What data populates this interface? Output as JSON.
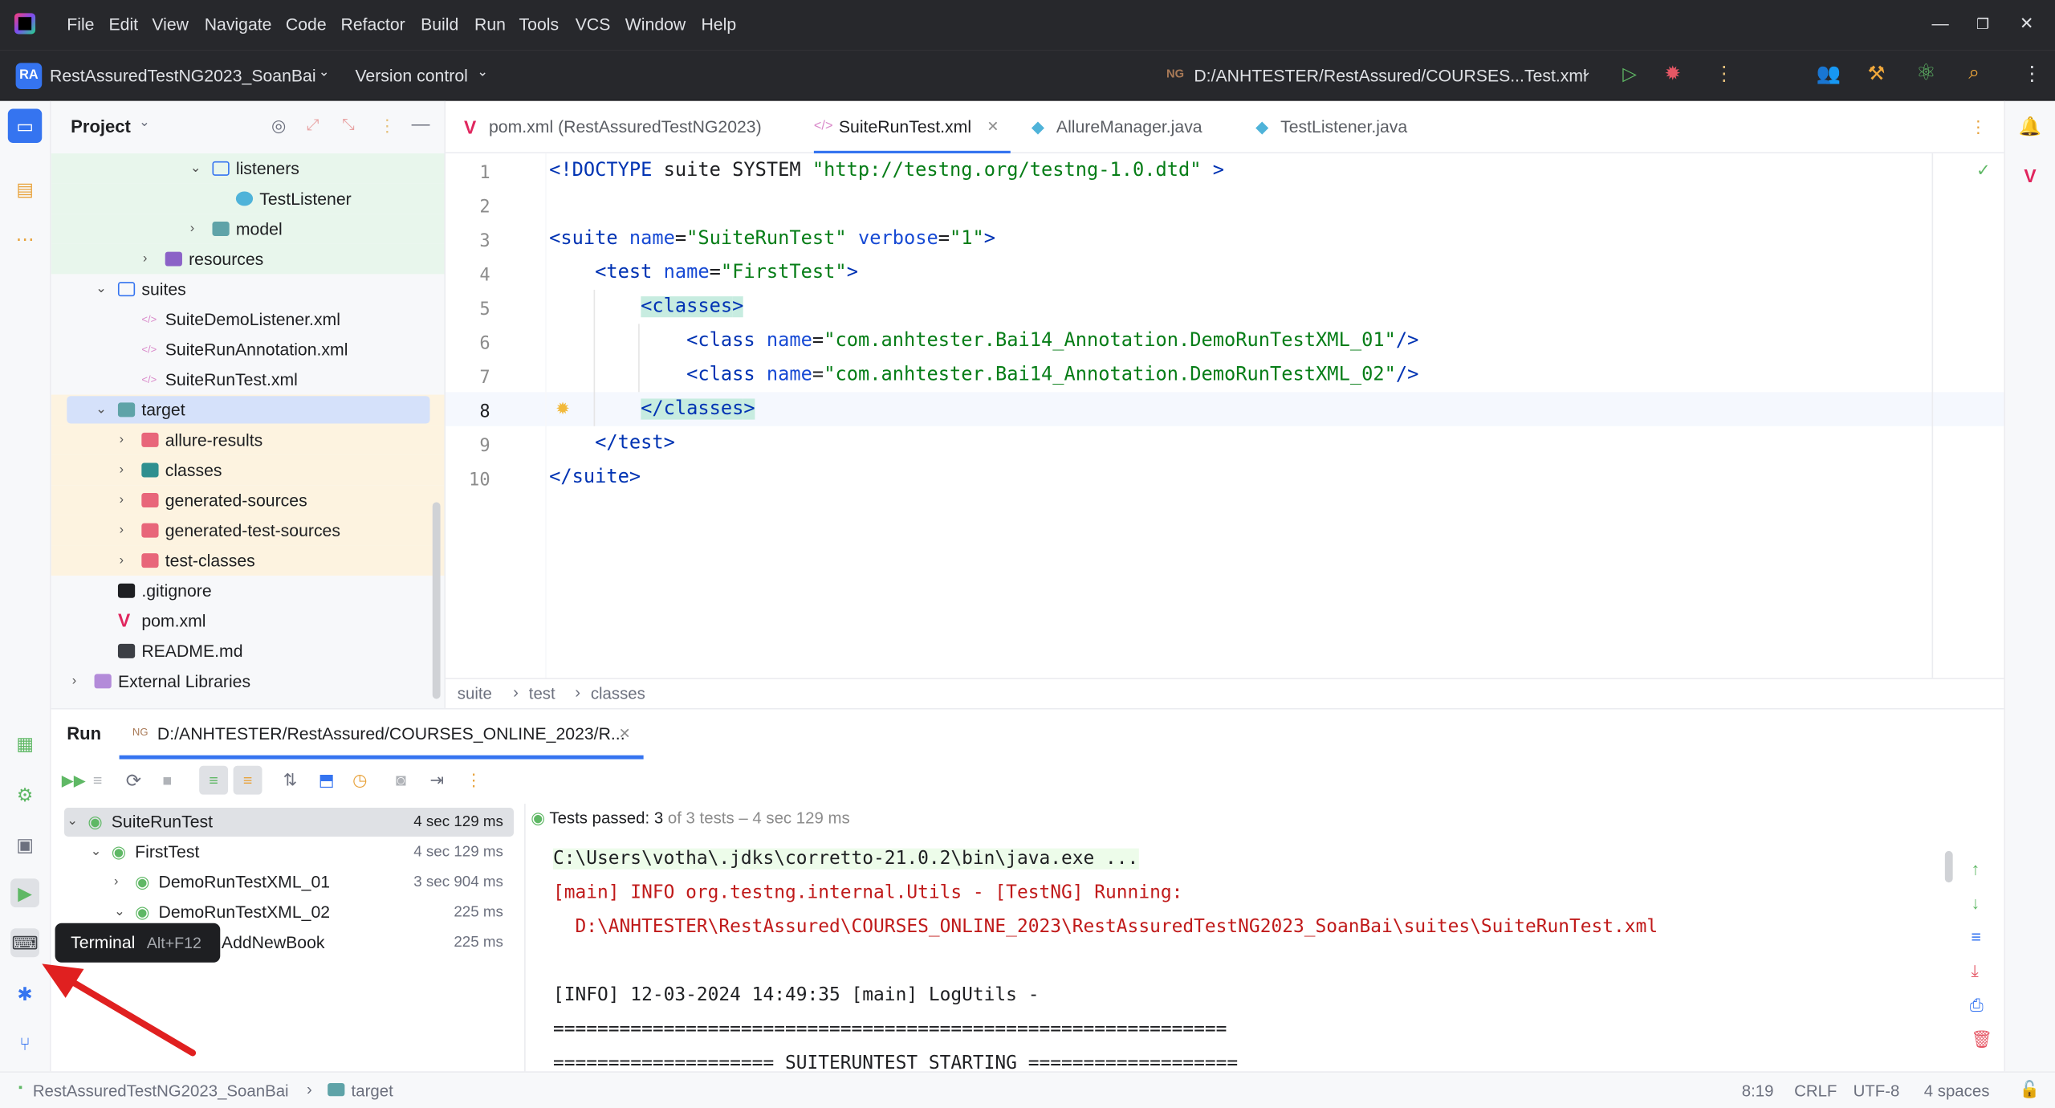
{
  "menu": [
    "File",
    "Edit",
    "View",
    "Navigate",
    "Code",
    "Refactor",
    "Build",
    "Run",
    "Tools",
    "VCS",
    "Window",
    "Help"
  ],
  "toolbar": {
    "project_badge": "RA",
    "project_name": "RestAssuredTestNG2023_SoanBai",
    "vcs_label": "Version control",
    "run_config": "D:/ANHTESTER/RestAssured/COURSES...Test.xml"
  },
  "project_panel": {
    "title": "Project",
    "items": [
      {
        "label": "listeners",
        "depth": 5,
        "type": "folder",
        "expanded": true
      },
      {
        "label": "TestListener",
        "depth": 6,
        "type": "class"
      },
      {
        "label": "model",
        "depth": 5,
        "type": "package",
        "expanded": false
      },
      {
        "label": "resources",
        "depth": 3,
        "type": "resources",
        "expanded": false
      },
      {
        "label": "suites",
        "depth": 1,
        "type": "folder",
        "expanded": true
      },
      {
        "label": "SuiteDemoListener.xml",
        "depth": 2,
        "type": "xml"
      },
      {
        "label": "SuiteRunAnnotation.xml",
        "depth": 2,
        "type": "xml"
      },
      {
        "label": "SuiteRunTest.xml",
        "depth": 2,
        "type": "xml"
      },
      {
        "label": "target",
        "depth": 1,
        "type": "target",
        "expanded": true
      },
      {
        "label": "allure-results",
        "depth": 2,
        "type": "excluded",
        "expanded": false
      },
      {
        "label": "classes",
        "depth": 2,
        "type": "excluded-teal",
        "expanded": false
      },
      {
        "label": "generated-sources",
        "depth": 2,
        "type": "excluded",
        "expanded": false
      },
      {
        "label": "generated-test-sources",
        "depth": 2,
        "type": "excluded",
        "expanded": false
      },
      {
        "label": "test-classes",
        "depth": 2,
        "type": "excluded",
        "expanded": false
      },
      {
        "label": ".gitignore",
        "depth": 1,
        "type": "git"
      },
      {
        "label": "pom.xml",
        "depth": 1,
        "type": "maven"
      },
      {
        "label": "README.md",
        "depth": 1,
        "type": "md"
      },
      {
        "label": "External Libraries",
        "depth": 0,
        "type": "lib",
        "expanded": false
      }
    ]
  },
  "tabs": [
    {
      "label": "pom.xml (RestAssuredTestNG2023)",
      "icon": "maven-icon",
      "active": false
    },
    {
      "label": "SuiteRunTest.xml",
      "icon": "xml-icon",
      "active": true
    },
    {
      "label": "AllureManager.java",
      "icon": "class-icon",
      "active": false
    },
    {
      "label": "TestListener.java",
      "icon": "class-icon",
      "active": false
    }
  ],
  "editor": {
    "line_numbers": [
      "1",
      "2",
      "3",
      "4",
      "5",
      "6",
      "7",
      "8",
      "9",
      "10"
    ],
    "lines": [
      "<!DOCTYPE suite SYSTEM \"http://testng.org/testng-1.0.dtd\" >",
      "",
      "<suite name=\"SuiteRunTest\" verbose=\"1\">",
      "    <test name=\"FirstTest\">",
      "        <classes>",
      "            <class name=\"com.anhtester.Bai14_Annotation.DemoRunTestXML_01\"/>",
      "            <class name=\"com.anhtester.Bai14_Annotation.DemoRunTestXML_02\"/>",
      "        </classes>",
      "    </test>",
      "</suite>"
    ],
    "current_line": 8
  },
  "breadcrumb": [
    "suite",
    "test",
    "classes"
  ],
  "run_panel": {
    "title": "Run",
    "tab_label": "D:/ANHTESTER/RestAssured/COURSES_ONLINE_2023/R...",
    "summary_prefix": "Tests passed: ",
    "summary_count": "3",
    "summary_rest": " of 3 tests – 4 sec 129 ms",
    "tree": [
      {
        "label": "SuiteRunTest",
        "time": "4 sec 129 ms",
        "depth": 0
      },
      {
        "label": "FirstTest",
        "time": "4 sec 129 ms",
        "depth": 1
      },
      {
        "label": "DemoRunTestXML_01",
        "time": "3 sec 904 ms",
        "depth": 2
      },
      {
        "label": "DemoRunTestXML_02",
        "time": "225 ms",
        "depth": 2
      },
      {
        "label": "AddNewBook",
        "time": "225 ms",
        "depth": 3
      }
    ],
    "console": [
      {
        "text": "C:\\Users\\votha\\.jdks\\corretto-21.0.2\\bin\\java.exe ...",
        "color": "#1e1f22",
        "bg": "#edfcea"
      },
      {
        "text": "[main] INFO org.testng.internal.Utils - [TestNG] Running:",
        "color": "#c01a1a"
      },
      {
        "text": "  D:\\ANHTESTER\\RestAssured\\COURSES_ONLINE_2023\\RestAssuredTestNG2023_SoanBai\\suites\\SuiteRunTest.xml",
        "color": "#c01a1a"
      },
      {
        "text": "",
        "color": "#1e1f22"
      },
      {
        "text": "[INFO] 12-03-2024 14:49:35 [main] LogUtils -",
        "color": "#1e1f22"
      },
      {
        "text": "=============================================================",
        "color": "#1e1f22"
      },
      {
        "text": "==================== SUITERUNTEST STARTING ===================",
        "color": "#1e1f22"
      }
    ]
  },
  "tooltip": {
    "label": "Terminal",
    "shortcut": "Alt+F12"
  },
  "statusbar": {
    "project": "RestAssuredTestNG2023_SoanBai",
    "folder": "target",
    "position": "8:19",
    "line_ending": "CRLF",
    "encoding": "UTF-8",
    "indent": "4 spaces"
  },
  "colors": {
    "accent": "#3574f0",
    "pass": "#369650",
    "annotation_arrow": "#e02020"
  }
}
